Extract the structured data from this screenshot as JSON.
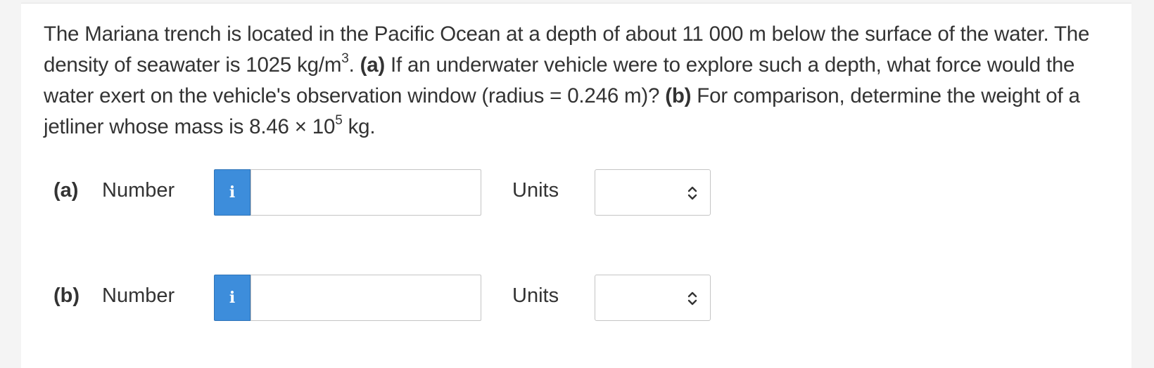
{
  "question": {
    "text_1": "The Mariana trench is located in the Pacific Ocean at a depth of about 11 000 m below the surface of the water. The density of seawater is 1025 kg/m",
    "sup_1": "3",
    "text_2": ". ",
    "part_a_tag": "(a)",
    "text_3": " If an underwater vehicle were to explore such a depth, what force would the water exert on the vehicle's observation window (radius = 0.246 m)? ",
    "part_b_tag": "(b)",
    "text_4": " For comparison, determine the weight of a jetliner whose mass is 8.46 × 10",
    "sup_2": "5",
    "text_5": " kg."
  },
  "answers": [
    {
      "part_label": "(a)",
      "number_label": "Number",
      "info_icon": "info-icon",
      "info_glyph": "i",
      "number_value": "",
      "units_label": "Units",
      "units_selected": ""
    },
    {
      "part_label": "(b)",
      "number_label": "Number",
      "info_icon": "info-icon",
      "info_glyph": "i",
      "number_value": "",
      "units_label": "Units",
      "units_selected": ""
    }
  ],
  "colors": {
    "accent": "#3d8ddb",
    "text": "#333333",
    "border": "#c4c4c4"
  }
}
